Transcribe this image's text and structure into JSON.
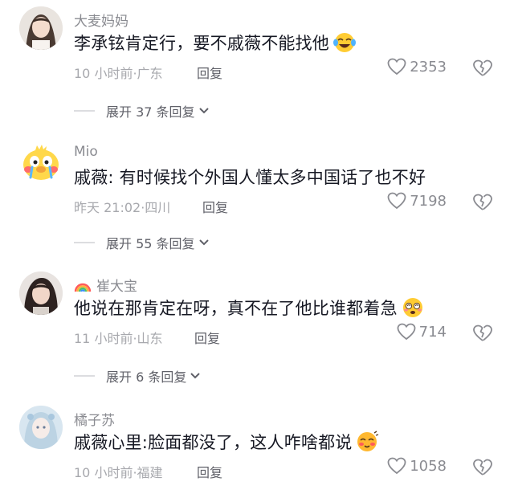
{
  "comments": [
    {
      "username": "大麦妈妈",
      "text": "李承铉肯定行，要不戚薇不能找他",
      "emoji": "laughing-crying-emoji",
      "time": "10 小时前",
      "location": "广东",
      "reply_label": "回复",
      "likes": "2353",
      "expand_label": "展开 37 条回复"
    },
    {
      "username": "Mio",
      "text": "戚薇: 有时候找个外国人懂太多中国话了也不好",
      "time": "昨天 21:02",
      "location": "四川",
      "reply_label": "回复",
      "likes": "7198",
      "expand_label": "展开 55 条回复"
    },
    {
      "username": "崔大宝",
      "username_badge": "rainbow-icon",
      "text": "他说在那肯定在呀，真不在了他比谁都着急",
      "emoji": "dizzy-face-emoji",
      "time": "11 小时前",
      "location": "山东",
      "reply_label": "回复",
      "likes": "714",
      "expand_label": "展开 6 条回复"
    },
    {
      "username": "橘子苏",
      "text": "戚薇心里:脸面都没了，这人咋啥都说",
      "emoji": "blushing-face-emoji",
      "time": "10 小时前",
      "location": "福建",
      "reply_label": "回复",
      "likes": "1058"
    }
  ],
  "colors": {
    "text": "#161823",
    "secondary": "#8a8b91",
    "muted": "#a7a8ad"
  }
}
